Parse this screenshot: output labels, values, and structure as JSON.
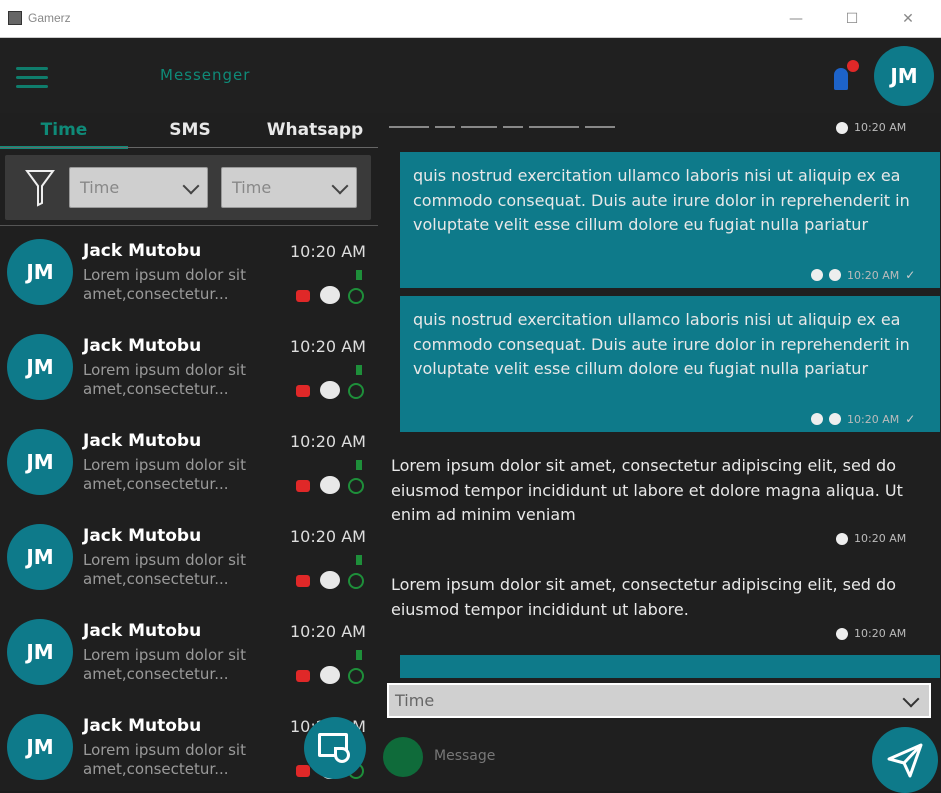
{
  "window": {
    "title": "Gamerz"
  },
  "appbar": {
    "app_name": "Messenger",
    "avatar_initials": "JM"
  },
  "tabs": [
    "Time",
    "SMS",
    "Whatsapp"
  ],
  "filters": {
    "select1": "Time",
    "select2": "Time"
  },
  "conversations": [
    {
      "initials": "JM",
      "name": "Jack Mutobu",
      "time": "10:20 AM",
      "preview": "Lorem ipsum dolor sit amet,consectetur..."
    },
    {
      "initials": "JM",
      "name": "Jack Mutobu",
      "time": "10:20 AM",
      "preview": "Lorem ipsum dolor sit amet,consectetur..."
    },
    {
      "initials": "JM",
      "name": "Jack Mutobu",
      "time": "10:20 AM",
      "preview": "Lorem ipsum dolor sit amet,consectetur..."
    },
    {
      "initials": "JM",
      "name": "Jack Mutobu",
      "time": "10:20 AM",
      "preview": "Lorem ipsum dolor sit amet,consectetur..."
    },
    {
      "initials": "JM",
      "name": "Jack Mutobu",
      "time": "10:20 AM",
      "preview": "Lorem ipsum dolor sit amet,consectetur..."
    },
    {
      "initials": "JM",
      "name": "Jack Mutobu",
      "time": "10:20 AM",
      "preview": "Lorem ipsum dolor sit amet,consectetur..."
    }
  ],
  "chat": {
    "top_meta_time": "10:20 AM",
    "outgoing": [
      {
        "text": "quis nostrud exercitation ullamco laboris nisi ut aliquip ex ea commodo consequat. Duis aute irure dolor in reprehenderit in voluptate velit esse cillum dolore eu fugiat nulla pariatur",
        "time": "10:20 AM"
      },
      {
        "text": "quis nostrud exercitation ullamco laboris nisi ut aliquip ex ea commodo consequat. Duis aute irure dolor in reprehenderit in voluptate velit esse cillum dolore eu fugiat nulla pariatur",
        "time": "10:20 AM"
      }
    ],
    "incoming": [
      {
        "text": "Lorem ipsum dolor sit amet, consectetur adipiscing elit, sed do eiusmod tempor incididunt ut labore et dolore magna aliqua. Ut enim ad minim veniam",
        "time": "10:20 AM"
      },
      {
        "text": "Lorem ipsum dolor sit amet, consectetur adipiscing elit, sed do eiusmod tempor incididunt ut labore.",
        "time": "10:20 AM"
      }
    ]
  },
  "compose": {
    "channel": "Time",
    "placeholder": "Message"
  }
}
